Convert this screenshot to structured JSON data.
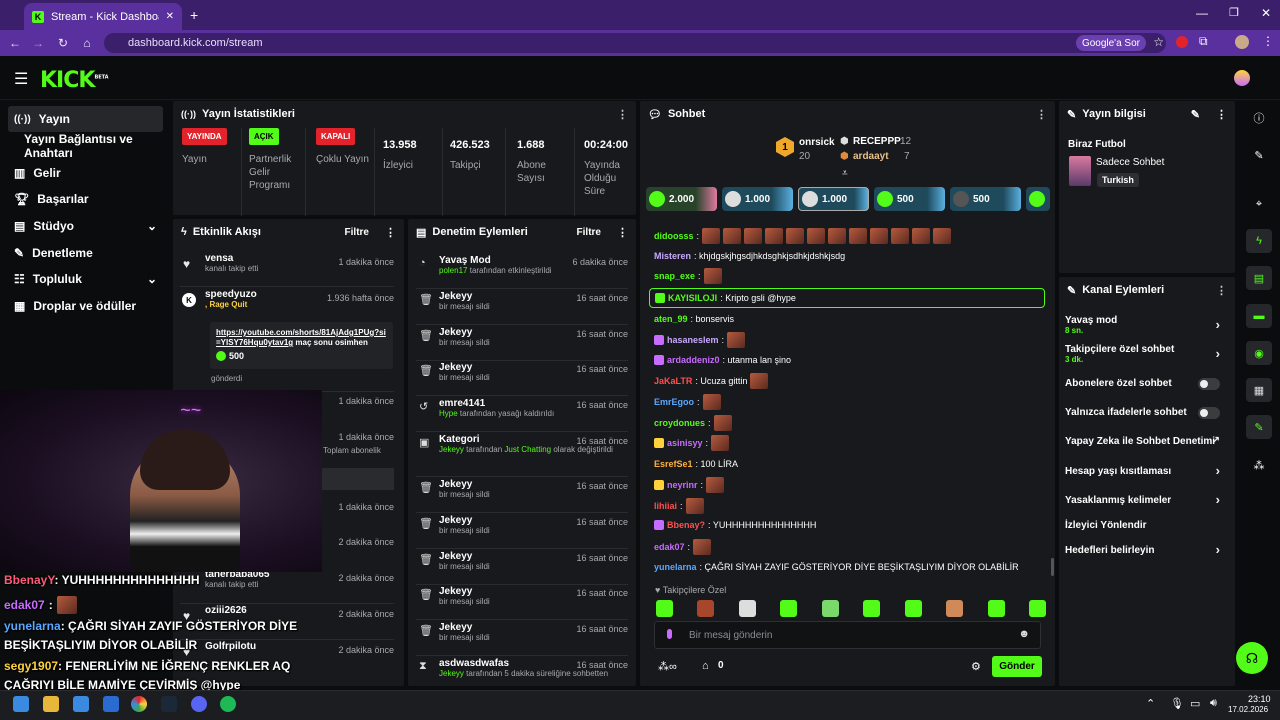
{
  "browser": {
    "tab_title": "Stream - Kick Dashboard",
    "url": "dashboard.kick.com/stream",
    "search_chip": "Google'a Sor"
  },
  "nav": {
    "logo": "KICK",
    "logo_tag": "BETA"
  },
  "sidebar": {
    "items": [
      {
        "label": "Yayın",
        "icon": "broadcast-icon"
      },
      {
        "label": "Yayın Bağlantısı ve Anahtarı",
        "icon": ""
      },
      {
        "label": "Gelir",
        "icon": "chart-icon"
      },
      {
        "label": "Başarılar",
        "icon": "trophy-icon"
      },
      {
        "label": "Stüdyo",
        "icon": "studio-icon"
      },
      {
        "label": "Denetleme",
        "icon": "wrench-icon"
      },
      {
        "label": "Topluluk",
        "icon": "community-icon"
      },
      {
        "label": "Droplar ve ödüller",
        "icon": "gift-icon"
      }
    ]
  },
  "stats": {
    "title": "Yayın İstatistikleri",
    "items": [
      {
        "badge": "YAYINDA",
        "label": "Yayın"
      },
      {
        "badge": "AÇIK",
        "label": "Partnerlik Gelir Programı"
      },
      {
        "badge": "KAPALI",
        "label": "Çoklu Yayın"
      },
      {
        "value": "13.958",
        "label": "İzleyici"
      },
      {
        "value": "426.523",
        "label": "Takipçi"
      },
      {
        "value": "1.688",
        "label": "Abone Sayısı"
      },
      {
        "value": "00:24:00",
        "label": "Yayında Olduğu Süre"
      }
    ]
  },
  "activity": {
    "title": "Etkinlik Akışı",
    "filter": "Filtre",
    "rows": [
      {
        "name": "vensa",
        "sub": "kanalı takip etti",
        "time": "1 dakika önce"
      },
      {
        "name": "speedyuzo",
        "sub": ", Rage Quit",
        "time": "1.936 hafta önce",
        "link": "https://youtube.com/shorts/81AjAdg1PUg?si=YISY76Hqu0ytav1g",
        "msg": "maç sonu osimhen",
        "amount": "500",
        "footer": "gönderdi"
      },
      {
        "time": "1 dakika önce"
      },
      {
        "time": "1 dakika önce",
        "sub": "Toplam abonelik"
      },
      {
        "time": "1 dakika önce"
      },
      {
        "time": "2 dakika önce"
      },
      {
        "name": "tanerbaba065",
        "sub": "kanalı takip etti",
        "time": "2 dakika önce"
      },
      {
        "name": "oziii2626",
        "time": "2 dakika önce"
      },
      {
        "name": "Golfrpilotu",
        "time": "2 dakika önce"
      }
    ]
  },
  "moderation": {
    "title": "Denetim Eylemleri",
    "filter": "Filtre",
    "rows": [
      {
        "name": "Yavaş Mod",
        "by": "polen17",
        "sub": "tarafından etkinleştirildi",
        "time": "6 dakika önce"
      },
      {
        "name": "Jekeyy",
        "sub": "bir mesajı sildi",
        "time": "16 saat önce"
      },
      {
        "name": "Jekeyy",
        "sub": "bir mesajı sildi",
        "time": "16 saat önce"
      },
      {
        "name": "Jekeyy",
        "sub": "bir mesajı sildi",
        "time": "16 saat önce"
      },
      {
        "name": "emre4141",
        "by": "Hype",
        "sub": "tarafından yasağı kaldırıldı",
        "time": "16 saat önce"
      },
      {
        "name": "Kategori",
        "by": "Jekeyy",
        "sub": "tarafından",
        "sub_hl": "Just Chatting",
        "sub2": "olarak değiştirildi",
        "time": "16 saat önce"
      },
      {
        "name": "Jekeyy",
        "sub": "bir mesajı sildi",
        "time": "16 saat önce"
      },
      {
        "name": "Jekeyy",
        "sub": "bir mesajı sildi",
        "time": "16 saat önce"
      },
      {
        "name": "Jekeyy",
        "sub": "bir mesajı sildi",
        "time": "16 saat önce"
      },
      {
        "name": "Jekeyy",
        "sub": "bir mesajı sildi",
        "time": "16 saat önce"
      },
      {
        "name": "Jekeyy",
        "sub": "bir mesajı sildi",
        "time": "16 saat önce"
      },
      {
        "name": "asdwasdwafas",
        "by": "Jekeyy",
        "sub": "tarafından 5 dakika süreliğine sohbetten",
        "time": "16 saat önce"
      }
    ]
  },
  "chat": {
    "title": "Sohbet",
    "leader": {
      "rank": "1",
      "name": "onrsick",
      "count": "20"
    },
    "top2": {
      "name": "RECEPPP",
      "count": "12"
    },
    "top3": {
      "name": "ardaayt",
      "count": "7"
    },
    "pills": [
      "2.000",
      "1.000",
      "1.000",
      "500",
      "500"
    ],
    "messages": [
      {
        "user": "didoosss",
        "color": "#53fc18",
        "text": ":"
      },
      {
        "user": "Misteren",
        "color": "#c8a8ff",
        "text": ": khjdgskjhgsdjhkdsghkjsdhkjdshkjsdg"
      },
      {
        "user": "snap_exe",
        "color": "#53fc18",
        "text": ":"
      },
      {
        "user": "KAYISILOJI",
        "color": "#53fc18",
        "text": ": Kripto gsli @hype"
      },
      {
        "user": "aten_99",
        "color": "#53fc18",
        "text": ": bonservis"
      },
      {
        "user": "hasaneslem",
        "color": "#c8a8ff",
        "text": ":"
      },
      {
        "user": "ardaddeniz0",
        "color": "#c8a8ff",
        "text": ": utanma lan şino"
      },
      {
        "user": "JaKaLTR",
        "color": "#ff4f4f",
        "text": ": Ucuza gittin"
      },
      {
        "user": "EmrEgoo",
        "color": "#5aa8ff",
        "text": ":"
      },
      {
        "user": "croydonues",
        "color": "#53fc18",
        "text": ":"
      },
      {
        "user": "asinisyy",
        "color": "#c86bff",
        "text": ":"
      },
      {
        "user": "EsrefSe1",
        "color": "#ffb13b",
        "text": ": 100 LİRA"
      },
      {
        "user": "neyrinr",
        "color": "#c86bff",
        "text": ":"
      },
      {
        "user": "lihiiai",
        "color": "#ff4f4f",
        "text": ":"
      },
      {
        "user": "Bbenay?",
        "color": "#ff4f4f",
        "text": ": YUHHHHHHHHHHHHHH"
      },
      {
        "user": "edak07",
        "color": "#c86bff",
        "text": ":"
      },
      {
        "user": "yunelarna",
        "color": "#5aa8ff",
        "text": ": ÇAĞRI SİYAH ZAYIF GÖSTERİYOR DİYE BEŞİKTAŞLIYIM DİYOR OLABİLİR"
      }
    ],
    "followers_only": "Takipçilere Özel",
    "placeholder": "Bir mesaj gönderin",
    "points": "0",
    "send": "Gönder"
  },
  "stream_info": {
    "title": "Yayın bilgisi",
    "stream_title": "Biraz Futbol",
    "category": "Sadece Sohbet",
    "language": "Turkish"
  },
  "channel_actions": {
    "title": "Kanal Eylemleri",
    "items": [
      {
        "label": "Yavaş mod",
        "sub": "8 sn.",
        "ctl": "chevron"
      },
      {
        "label": "Takipçilere özel sohbet",
        "sub": "3 dk.",
        "ctl": "chevron"
      },
      {
        "label": "Abonelere özel sohbet",
        "ctl": "toggle"
      },
      {
        "label": "Yalnızca ifadelerle sohbet",
        "ctl": "toggle"
      },
      {
        "label": "Yapay Zeka ile Sohbet Denetimi",
        "ctl": "external"
      },
      {
        "label": "Hesap yaşı kısıtlaması",
        "ctl": "chevron"
      },
      {
        "label": "Yasaklanmış kelimeler",
        "ctl": "chevron"
      },
      {
        "label": "İzleyici Yönlendir",
        "ctl": ""
      },
      {
        "label": "Hedefleri belirleyin",
        "ctl": "chevron"
      }
    ]
  },
  "overlay_chat": [
    {
      "user": "BbenayY",
      "color": "#ff5a7a",
      "text": ": YUHHHHHHHHHHHHHH"
    },
    {
      "user": "edak07",
      "color": "#c86bff",
      "text": ":"
    },
    {
      "user": "yunelarna",
      "color": "#5aa8ff",
      "text": ": ÇAĞRI SİYAH ZAYIF GÖSTERİYOR DİYE"
    },
    {
      "user": "",
      "color": "#fff",
      "text": "BEŞİKTAŞLIYIM DİYOR OLABİLİR"
    },
    {
      "user": "segy1907",
      "color": "#ffd23b",
      "text": ": FENERLİYİM NE İĞRENÇ RENKLER AQ"
    },
    {
      "user": "",
      "color": "#fff",
      "text": "ÇAĞRIYI BİLE MAMİYE ÇEVİRMİŞ @hype"
    }
  ],
  "taskbar": {
    "time": "23:10",
    "date": "17.02.2026"
  }
}
